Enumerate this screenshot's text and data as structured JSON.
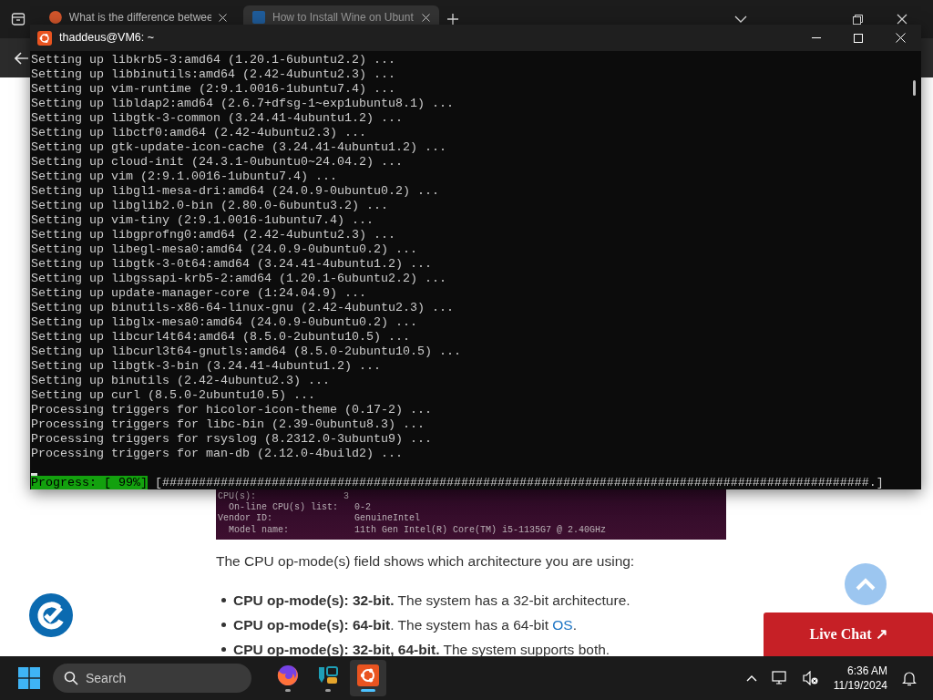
{
  "browser": {
    "tabs": [
      {
        "title": "What is the difference betwee",
        "selected": false
      },
      {
        "title": "How to Install Wine on Ubunt",
        "selected": true
      }
    ]
  },
  "terminal": {
    "title": "thaddeus@VM6: ~",
    "lines": [
      "Setting up libkrb5-3:amd64 (1.20.1-6ubuntu2.2) ...",
      "Setting up libbinutils:amd64 (2.42-4ubuntu2.3) ...",
      "Setting up vim-runtime (2:9.1.0016-1ubuntu7.4) ...",
      "Setting up libldap2:amd64 (2.6.7+dfsg-1~exp1ubuntu8.1) ...",
      "Setting up libgtk-3-common (3.24.41-4ubuntu1.2) ...",
      "Setting up libctf0:amd64 (2.42-4ubuntu2.3) ...",
      "Setting up gtk-update-icon-cache (3.24.41-4ubuntu1.2) ...",
      "Setting up cloud-init (24.3.1-0ubuntu0~24.04.2) ...",
      "Setting up vim (2:9.1.0016-1ubuntu7.4) ...",
      "Setting up libgl1-mesa-dri:amd64 (24.0.9-0ubuntu0.2) ...",
      "Setting up libglib2.0-bin (2.80.0-6ubuntu3.2) ...",
      "Setting up vim-tiny (2:9.1.0016-1ubuntu7.4) ...",
      "Setting up libgprofng0:amd64 (2.42-4ubuntu2.3) ...",
      "Setting up libegl-mesa0:amd64 (24.0.9-0ubuntu0.2) ...",
      "Setting up libgtk-3-0t64:amd64 (3.24.41-4ubuntu1.2) ...",
      "Setting up libgssapi-krb5-2:amd64 (1.20.1-6ubuntu2.2) ...",
      "Setting up update-manager-core (1:24.04.9) ...",
      "Setting up binutils-x86-64-linux-gnu (2.42-4ubuntu2.3) ...",
      "Setting up libglx-mesa0:amd64 (24.0.9-0ubuntu0.2) ...",
      "Setting up libcurl4t64:amd64 (8.5.0-2ubuntu10.5) ...",
      "Setting up libcurl3t64-gnutls:amd64 (8.5.0-2ubuntu10.5) ...",
      "Setting up libgtk-3-bin (3.24.41-4ubuntu1.2) ...",
      "Setting up binutils (2.42-4ubuntu2.3) ...",
      "Setting up curl (8.5.0-2ubuntu10.5) ...",
      "Processing triggers for hicolor-icon-theme (0.17-2) ...",
      "Processing triggers for libc-bin (2.39-0ubuntu8.3) ...",
      "Processing triggers for rsyslog (8.2312.0-3ubuntu9) ...",
      "Processing triggers for man-db (2.12.0-4build2) ..."
    ],
    "progress_label": "Progress: [ 99%]",
    "progress_bar": "[#################################################################################################.]"
  },
  "article": {
    "figure_lines": [
      "CPU(s):                3",
      "  On-line CPU(s) list:   0-2",
      "Vendor ID:               GenuineIntel",
      "  Model name:            11th Gen Intel(R) Core(TM) i5-1135G7 @ 2.40GHz"
    ],
    "paragraph": "The CPU op-mode(s) field shows which architecture you are using:",
    "bullets": [
      {
        "text": "**CPU op-mode(s): 32-bit.** The system has a 32-bit architecture."
      },
      {
        "text": "**CPU op-mode(s): 64-bit**. The system has a 64-bit ",
        "link": "OS",
        "tail": "."
      },
      {
        "text": "**CPU op-mode(s): 32-bit, 64-bit.** The system supports both."
      }
    ]
  },
  "live_chat": "Live Chat ↗",
  "taskbar": {
    "search_placeholder": "Search",
    "apps": [
      {
        "kind": "firefox",
        "selected": false
      },
      {
        "kind": "editor",
        "selected": false
      },
      {
        "kind": "ubuntu",
        "selected": true
      }
    ],
    "time": "6:36 AM",
    "date": "11/19/2024"
  }
}
